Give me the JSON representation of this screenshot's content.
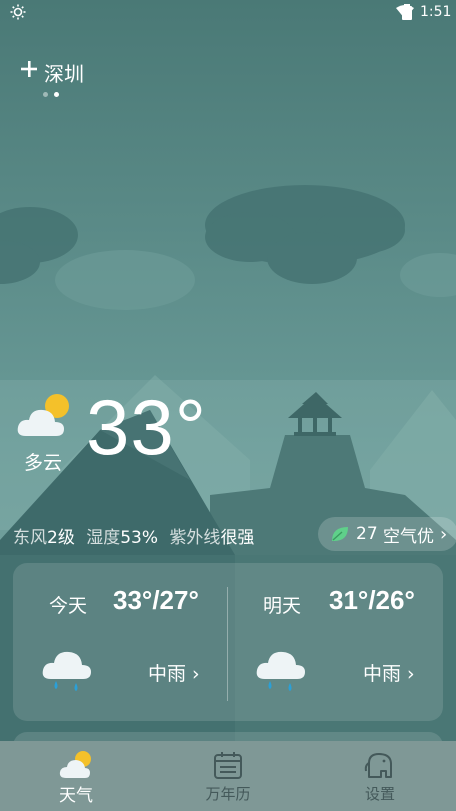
{
  "status_bar": {
    "time": "1:51"
  },
  "header": {
    "city": "深圳",
    "page_dots": 2,
    "active_dot": 1
  },
  "current": {
    "temperature": "33°",
    "condition": "多云",
    "icon": "partly-cloudy-icon",
    "wind_label": "东风",
    "wind_value": "2级",
    "humidity_label": "湿度",
    "humidity_value": "53%",
    "uv_label": "紫外线",
    "uv_value": "很强",
    "aqi_value": "27",
    "aqi_text": "空气优"
  },
  "forecast": [
    {
      "day": "今天",
      "temp": "33°/27°",
      "condition": "中雨",
      "icon": "rain-cloud-icon"
    },
    {
      "day": "明天",
      "temp": "31°/26°",
      "condition": "中雨",
      "icon": "rain-cloud-icon"
    }
  ],
  "nav": [
    {
      "label": "天气",
      "icon": "weather-icon",
      "active": true
    },
    {
      "label": "万年历",
      "icon": "calendar-icon",
      "active": false
    },
    {
      "label": "设置",
      "icon": "elephant-settings-icon",
      "active": false
    }
  ],
  "colors": {
    "background": "#4f7d7b",
    "mountain": "#3f6c6b",
    "nav_bg": "#7f9896",
    "sun": "#f4c12a",
    "rain_drop": "#2aa0d8"
  }
}
